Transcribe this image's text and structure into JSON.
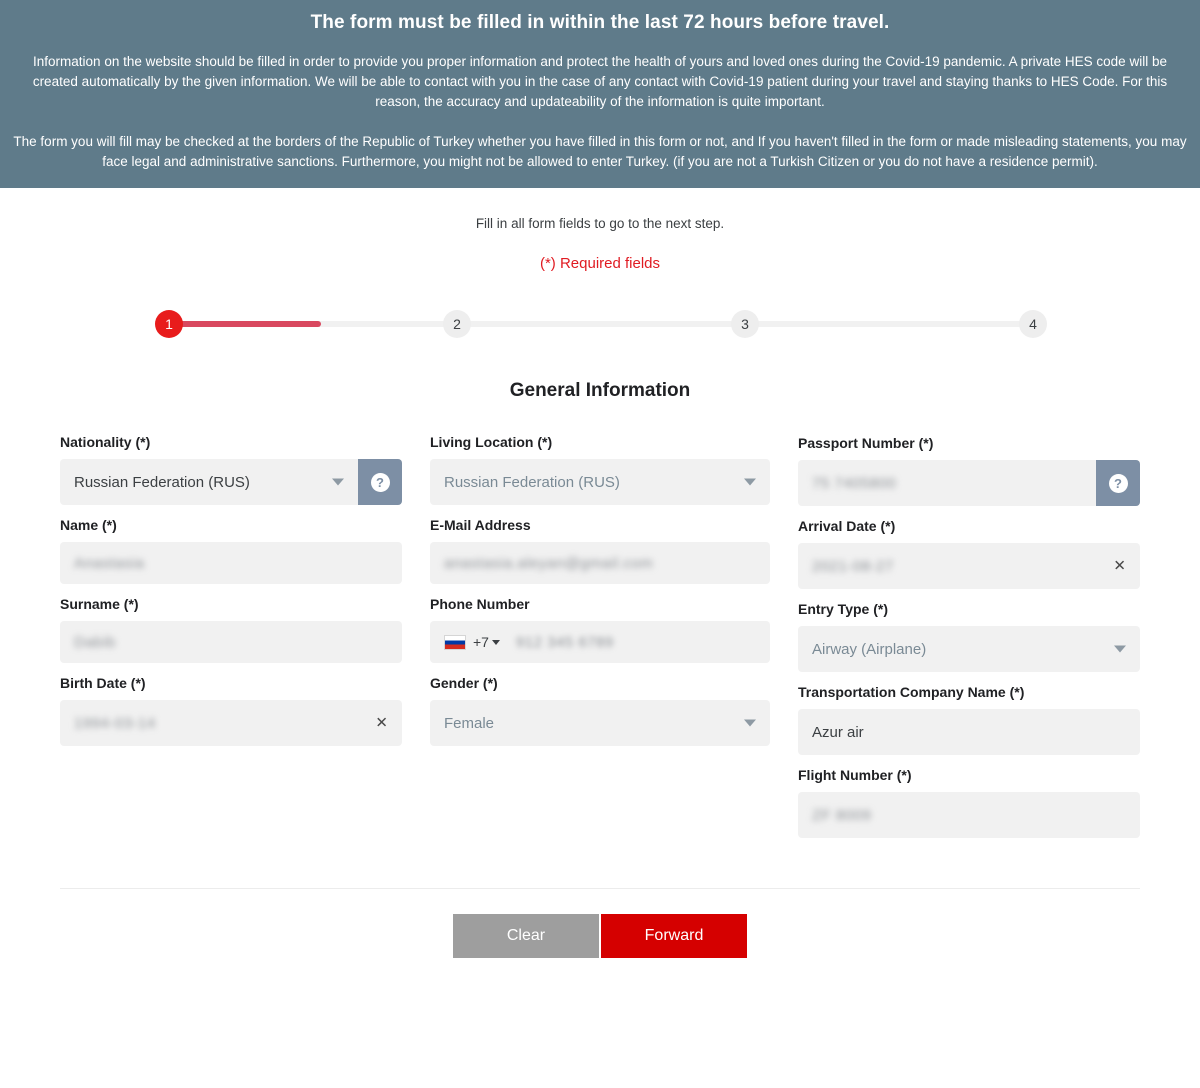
{
  "banner": {
    "title": "The form must be filled in within the last 72 hours before travel.",
    "paragraph1": "Information on the website should be filled in order to provide you proper information and protect the health of yours and loved ones during the Covid-19 pandemic. A private HES code will be created automatically by the given information. We will be able to contact with you in the case of any contact with Covid-19 patient during your travel and staying thanks to HES Code. For this reason, the accuracy and updateability of the information is quite important.",
    "paragraph2": "The form you will fill may be checked at the borders of the Republic of Turkey whether you have filled in this form or not, and If you haven't filled in the form or made misleading statements, you may face legal and administrative sanctions. Furthermore, you might not be allowed to enter Turkey. (if you are not a Turkish Citizen or you do not have a residence permit).",
    "background_color": "#5f7b8a"
  },
  "intro": {
    "instruction": "Fill in all form fields to go to the next step.",
    "required_note": "(*) Required fields",
    "required_note_color": "#e01b22"
  },
  "stepper": {
    "steps": [
      {
        "label": "1",
        "state": "active"
      },
      {
        "label": "2",
        "state": "inactive"
      },
      {
        "label": "3",
        "state": "inactive"
      },
      {
        "label": "4",
        "state": "inactive"
      }
    ],
    "active_color": "#e81c1c",
    "progress_color": "#d9485f",
    "track_color": "#f1f1f1"
  },
  "section": {
    "title": "General Information"
  },
  "fields": {
    "nationality": {
      "label": "Nationality (*)",
      "value": "Russian Federation (RUS)",
      "help_icon": "question-mark-icon"
    },
    "name": {
      "label": "Name (*)",
      "value": "Anastasia"
    },
    "surname": {
      "label": "Surname (*)",
      "value": "Dabib"
    },
    "birth_date": {
      "label": "Birth Date (*)",
      "value": "1994-03-14",
      "clear_icon": "close-icon"
    },
    "living_location": {
      "label": "Living Location (*)",
      "value": "Russian Federation (RUS)"
    },
    "email": {
      "label": "E-Mail Address",
      "value": "anastasia.aleyan@gmail.com"
    },
    "phone": {
      "label": "Phone Number",
      "dial_code": "+7",
      "flag": "russia-flag-icon",
      "value": "912 345 6789"
    },
    "gender": {
      "label": "Gender (*)",
      "value": "Female"
    },
    "passport_number": {
      "label": "Passport Number (*)",
      "value": "75 7405800",
      "help_icon": "question-mark-icon"
    },
    "arrival_date": {
      "label": "Arrival Date (*)",
      "value": "2021-08-27",
      "clear_icon": "close-icon"
    },
    "entry_type": {
      "label": "Entry Type (*)",
      "value": "Airway (Airplane)"
    },
    "transportation_company": {
      "label": "Transportation Company Name (*)",
      "value": "Azur air"
    },
    "flight_number": {
      "label": "Flight Number (*)",
      "value": "ZF 8009"
    }
  },
  "actions": {
    "clear_label": "Clear",
    "forward_label": "Forward",
    "clear_color": "#9e9e9e",
    "forward_color": "#d50000"
  }
}
